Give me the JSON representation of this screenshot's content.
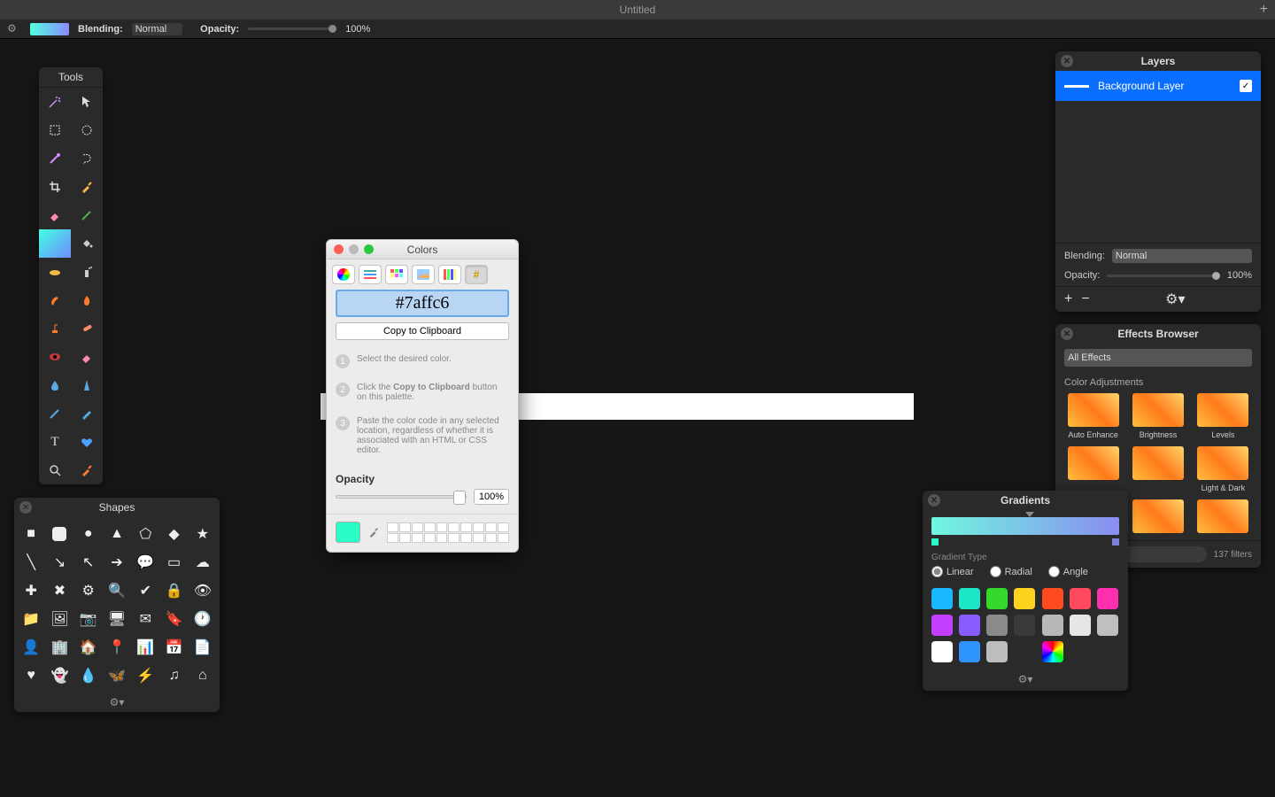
{
  "titlebar": {
    "title": "Untitled"
  },
  "options": {
    "blending_label": "Blending:",
    "blending_value": "Normal",
    "opacity_label": "Opacity:",
    "opacity_value": "100%"
  },
  "tools": {
    "title": "Tools"
  },
  "shapes": {
    "title": "Shapes"
  },
  "colors": {
    "title": "Colors",
    "hex": "#7affc6",
    "copy_label": "Copy to Clipboard",
    "step1": "Select the desired color.",
    "step2_pre": "Click the ",
    "step2_bold": "Copy to Clipboard",
    "step2_post": " button on this palette.",
    "step3": "Paste the color code in any selected location, regardless of whether it is associated with an HTML or CSS editor.",
    "opacity_label": "Opacity",
    "opacity_value": "100%"
  },
  "layers": {
    "title": "Layers",
    "item_label": "Background Layer",
    "blending_label": "Blending:",
    "blending_value": "Normal",
    "opacity_label": "Opacity:",
    "opacity_value": "100%"
  },
  "effects": {
    "title": "Effects Browser",
    "filter_value": "All Effects",
    "category": "Color Adjustments",
    "items": [
      "Auto Enhance",
      "Brightness",
      "Levels",
      "",
      "",
      "Light & Dark",
      "",
      "",
      ""
    ],
    "count": "137 filters"
  },
  "gradients": {
    "title": "Gradients",
    "type_label": "Gradient Type",
    "types": [
      "Linear",
      "Radial",
      "Angle"
    ],
    "swatch_colors": [
      "#19b9ff",
      "#1de6c8",
      "#34d92b",
      "#ffd21f",
      "#ff4a1f",
      "#ff4a5d",
      "#ff2fb0",
      "#c23fff",
      "#8a5cff",
      "#8a8a8a",
      "#3a3a3a",
      "#b8b8b8",
      "#e6e6e6",
      "#bfbfbf",
      "#ffffff",
      "#2e95ff",
      "#bdbdbd",
      "#2b2b2b",
      "#ff7a7a"
    ]
  }
}
